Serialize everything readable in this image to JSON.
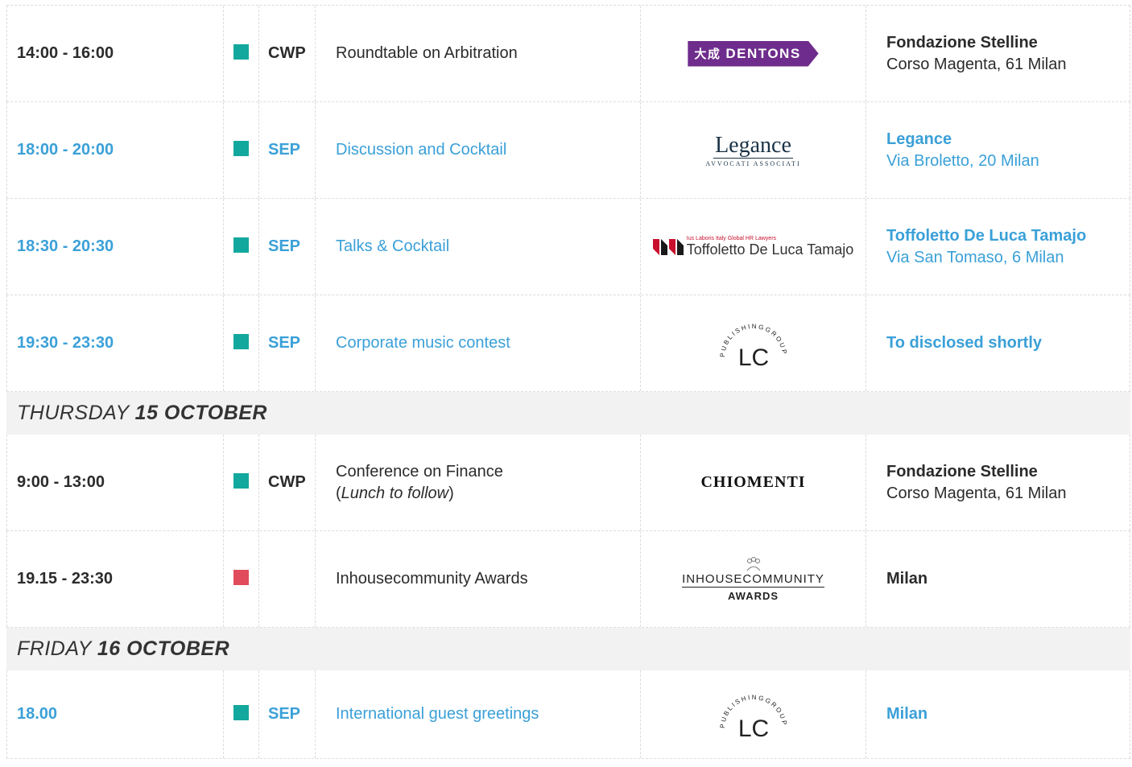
{
  "colors": {
    "accent_link": "#3aa0d8",
    "green_marker": "#13a89e",
    "red_marker": "#e04c5c",
    "day_band": "#f2f2f2",
    "dentons_purple": "#6e2c8c"
  },
  "events_wed": [
    {
      "time": "14:00 - 16:00",
      "code": "CWP",
      "title": "Roundtable on Arbitration",
      "logo": "dentons-logo",
      "logo_text": "DENTONS",
      "logo_cjk": "大成",
      "venue_name": "Fondazione Stelline",
      "venue_addr": "Corso Magenta, 61 Milan"
    },
    {
      "time": "18:00 - 20:00",
      "code": "SEP",
      "title": "Discussion and Cocktail",
      "logo": "legance-logo",
      "logo_text": "Legance",
      "logo_sub": "AVVOCATI ASSOCIATI",
      "venue_name": "Legance",
      "venue_addr": "Via Broletto, 20 Milan"
    },
    {
      "time": "18:30 - 20:30",
      "code": "SEP",
      "title": "Talks & Cocktail",
      "logo": "toffoletto-logo",
      "logo_tag": "Ius Laboris Italy Global HR Lawyers",
      "logo_text": "Toffoletto De Luca Tamajo",
      "venue_name": "Toffoletto De Luca Tamajo",
      "venue_addr": "Via San Tomaso, 6 Milan"
    },
    {
      "time": "19:30 - 23:30",
      "code": "SEP",
      "title": "Corporate music contest",
      "logo": "lc-publishing-logo",
      "venue_name": "To disclosed shortly",
      "venue_addr": ""
    }
  ],
  "day_thu": {
    "weekday": "THURSDAY",
    "date": "15 OCTOBER"
  },
  "events_thu": [
    {
      "time": "9:00 - 13:00",
      "code": "CWP",
      "title_line1": "Conference on Finance",
      "title_line2_open": "(",
      "title_line2_italic": "Lunch to follow",
      "title_line2_close": ")",
      "logo": "chiomenti-logo",
      "logo_text": "CHIOMENTI",
      "venue_name": "Fondazione Stelline",
      "venue_addr": "Corso Magenta, 61 Milan"
    },
    {
      "time": "19.15 - 23:30",
      "code": "",
      "title": "Inhousecommunity Awards",
      "logo": "inhousecommunity-awards-logo",
      "logo_text": "INHOUSECOMMUNITY",
      "logo_sub": "AWARDS",
      "venue_name": "Milan",
      "venue_addr": ""
    }
  ],
  "day_fri": {
    "weekday": "FRIDAY",
    "date": "16 OCTOBER"
  },
  "events_fri": [
    {
      "time": "18.00",
      "code": "SEP",
      "title": "International guest greetings",
      "logo": "lc-publishing-logo",
      "venue_name": "Milan",
      "venue_addr": ""
    }
  ],
  "lc_logo": {
    "arc_text": "PUBLISHINGGROUP",
    "letters": "LC"
  }
}
